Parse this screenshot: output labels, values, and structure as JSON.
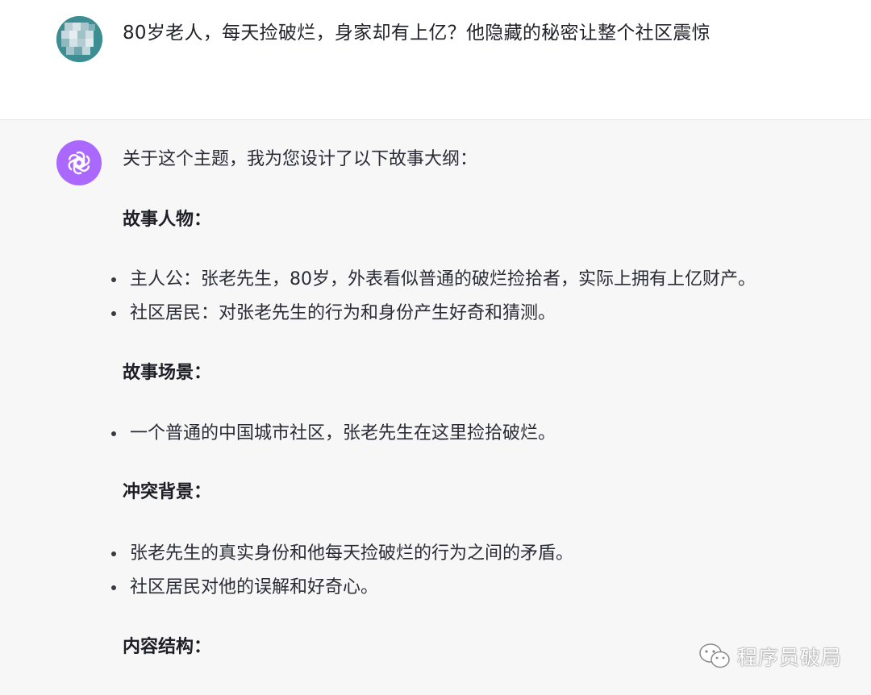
{
  "user_message": {
    "text": "80岁老人，每天捡破烂，身家却有上亿？他隐藏的秘密让整个社区震惊"
  },
  "assistant_message": {
    "intro": "关于这个主题，我为您设计了以下故事大纲：",
    "sections": [
      {
        "heading": "故事人物：",
        "bullets": [
          "主人公：张老先生，80岁，外表看似普通的破烂捡拾者，实际上拥有上亿财产。",
          "社区居民：对张老先生的行为和身份产生好奇和猜测。"
        ]
      },
      {
        "heading": "故事场景：",
        "bullets": [
          "一个普通的中国城市社区，张老先生在这里捡拾破烂。"
        ]
      },
      {
        "heading": "冲突背景：",
        "bullets": [
          "张老先生的真实身份和他每天捡破烂的行为之间的矛盾。",
          "社区居民对他的误解和好奇心。"
        ]
      },
      {
        "heading": "内容结构："
      }
    ]
  },
  "watermark": {
    "text": "程序员破局",
    "icon": "wechat-icon"
  },
  "colors": {
    "assistant_avatar_bg": "#ab68ff",
    "assistant_bg": "#f7f7f8",
    "user_avatar_bg": "#3a8f95"
  }
}
